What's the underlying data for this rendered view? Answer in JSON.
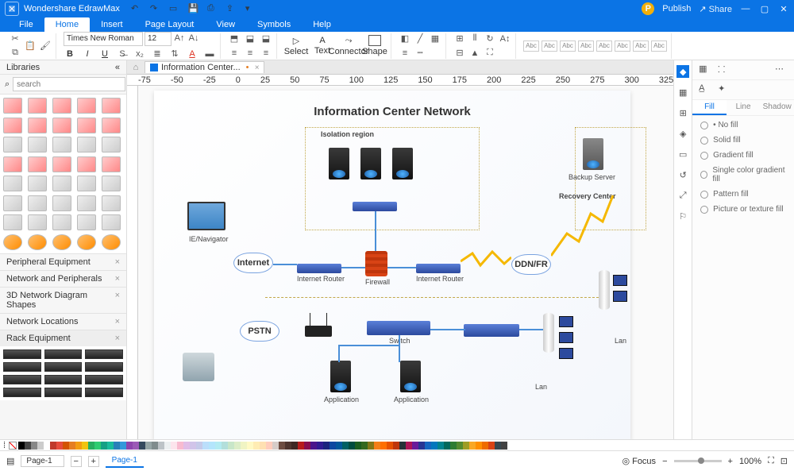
{
  "app": {
    "title": "Wondershare EdrawMax"
  },
  "titlebar_right": {
    "publish": "Publish",
    "share": "Share"
  },
  "menus": [
    "File",
    "Home",
    "Insert",
    "Page Layout",
    "View",
    "Symbols",
    "Help"
  ],
  "active_menu": 1,
  "ribbon": {
    "font_name": "Times New Roman",
    "font_size": "12",
    "tools": {
      "select": "Select",
      "text": "Text",
      "connector": "Connector",
      "shape": "Shape"
    },
    "sample": "Abc"
  },
  "libraries": {
    "title": "Libraries",
    "search_placeholder": "search",
    "categories": [
      "Peripheral Equipment",
      "Network and Peripherals",
      "3D Network Diagram Shapes",
      "Network Locations"
    ],
    "rack_title": "Rack Equipment"
  },
  "doc_tab": "Information Center...",
  "ruler_marks": [
    "-75",
    "-50",
    "-25",
    "0",
    "25",
    "50",
    "75",
    "100",
    "125",
    "150",
    "175",
    "200",
    "225",
    "250",
    "275",
    "300",
    "325"
  ],
  "diagram": {
    "title": "Information Center Network",
    "labels": {
      "isolation": "Isolation region",
      "backup": "Backup Server",
      "recovery": "Recovery Center",
      "ienav": "IE/Navigator",
      "internet": "Internet",
      "irouter": "Internet Router",
      "firewall": "Firewall",
      "ddn": "DDN/FR",
      "pstn": "PSTN",
      "switch": "Switch",
      "application": "Application",
      "lan": "Lan"
    }
  },
  "fill_panel": {
    "tabs": [
      "Fill",
      "Line",
      "Shadow"
    ],
    "active": 0,
    "opts": [
      "No fill",
      "Solid fill",
      "Gradient fill",
      "Single color gradient fill",
      "Pattern fill",
      "Picture or texture fill"
    ]
  },
  "status": {
    "page_sel": "Page-1",
    "page_tab": "Page-1",
    "focus": "Focus",
    "zoom": "100%"
  },
  "colors": [
    "#000",
    "#444",
    "#888",
    "#ccc",
    "#fff",
    "#c0392b",
    "#e74c3c",
    "#d35400",
    "#e67e22",
    "#f39c12",
    "#f1c40f",
    "#27ae60",
    "#2ecc71",
    "#16a085",
    "#1abc9c",
    "#2980b9",
    "#3498db",
    "#8e44ad",
    "#9b59b6",
    "#34495e",
    "#95a5a6",
    "#7f8c8d",
    "#bdc3c7",
    "#ecf0f1",
    "#fce4ec",
    "#f8bbd0",
    "#e1bee7",
    "#d1c4e9",
    "#c5cae9",
    "#bbdefb",
    "#b3e5fc",
    "#b2ebf2",
    "#b2dfdb",
    "#c8e6c9",
    "#dcedc8",
    "#f0f4c3",
    "#fff9c4",
    "#ffecb3",
    "#ffe0b2",
    "#ffccbc",
    "#d7ccc8",
    "#6d4c41",
    "#4e342e",
    "#3e2723",
    "#b71c1c",
    "#880e4f",
    "#4a148c",
    "#311b92",
    "#1a237e",
    "#0d47a1",
    "#01579b",
    "#006064",
    "#004d40",
    "#1b5e20",
    "#33691e",
    "#827717",
    "#f57f17",
    "#ff6f00",
    "#e65100",
    "#bf360c",
    "#263238",
    "#ad1457",
    "#6a1b9a",
    "#283593",
    "#1565c0",
    "#0277bd",
    "#00838f",
    "#00695c",
    "#2e7d32",
    "#558b2f",
    "#9e9d24",
    "#f9a825",
    "#ff8f00",
    "#ef6c00",
    "#d84315",
    "#37474f",
    "#424242"
  ]
}
